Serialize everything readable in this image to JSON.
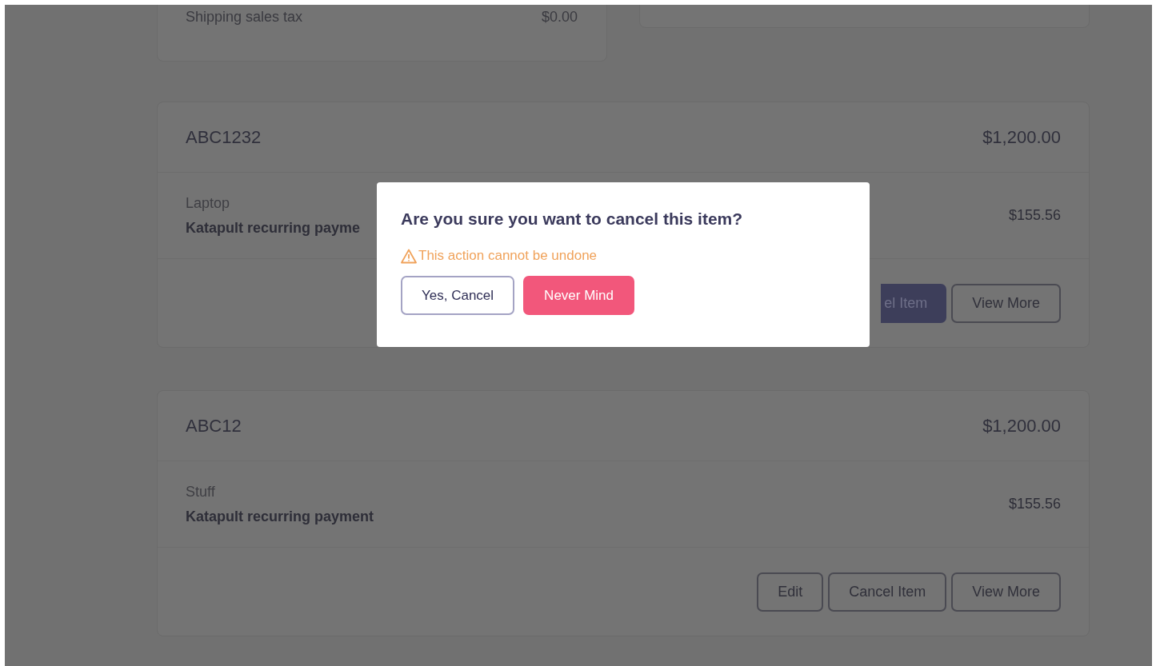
{
  "summary": {
    "label": "Shipping sales tax",
    "amount": "$0.00"
  },
  "items": [
    {
      "code": "ABC1232",
      "total": "$1,200.00",
      "name": "Laptop",
      "payment": "Katapult recurring payme",
      "amount": "$155.56",
      "buttons": [
        {
          "label": "el Item",
          "kind": "filled"
        },
        {
          "label": "View More",
          "kind": "outline"
        }
      ]
    },
    {
      "code": "ABC12",
      "total": "$1,200.00",
      "name": "Stuff",
      "payment": "Katapult recurring payment",
      "amount": "$155.56",
      "buttons": [
        {
          "label": "Edit",
          "kind": "outline"
        },
        {
          "label": "Cancel Item",
          "kind": "outline"
        },
        {
          "label": "View More",
          "kind": "outline"
        }
      ]
    }
  ],
  "dialog": {
    "title": "Are you sure you want to cancel this item?",
    "warning": "This action cannot be undone",
    "buttons": [
      {
        "label": "Yes, Cancel",
        "kind": "secondary"
      },
      {
        "label": "Never Mind",
        "kind": "primary"
      }
    ]
  }
}
